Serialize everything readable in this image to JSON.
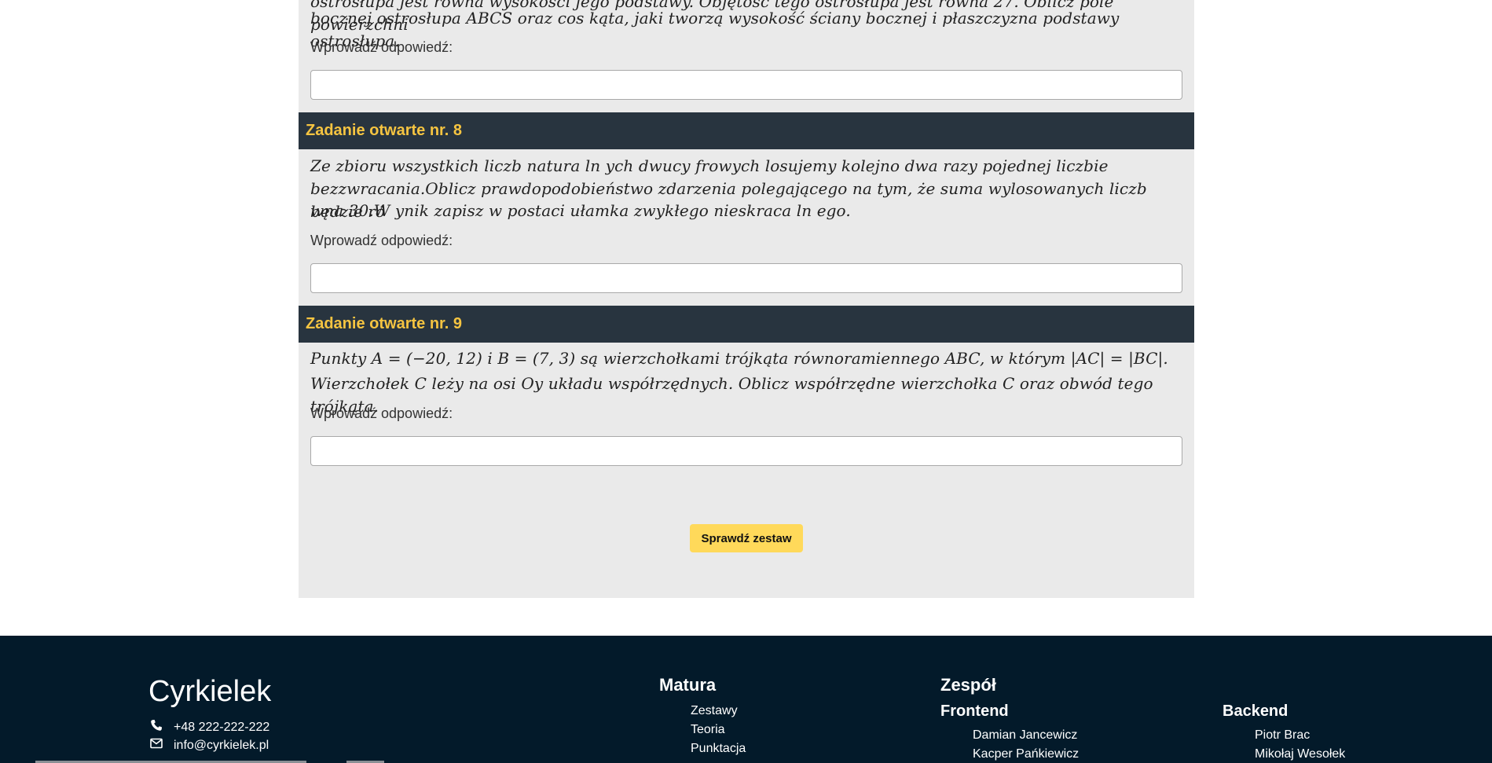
{
  "tasks": {
    "prev": {
      "question_line1": "ostrosłupa jest równa wysokości jego podstawy. Objętość tego ostrosłupa jest równa 27. Oblicz pole powierzchni",
      "question_line2": "bocznej ostrosłupa ABCS oraz cos kąta,  jaki tworzą wysokość ściany bocznej i płaszczyzna podstawy ostrosłupa.",
      "answer_label": "Wprowadź odpowiedź:",
      "answer_value": ""
    },
    "task8": {
      "header": "Zadanie otwarte nr. 8",
      "question_line1": "Ze zbioru wszystkich liczb natura ln ych dwucy frowych losujemy kolejno dwa razy pojednej liczbie",
      "question_line2": "bezzwracania.Oblicz prawdopodobieństwo zdarzenia polegającego na tym, że suma wylosowanych liczb będzie ró",
      "question_line3": "wna 30.W ynik zapisz w postaci ułamka zwykłego nieskraca ln ego.",
      "answer_label": "Wprowadź odpowiedź:",
      "answer_value": ""
    },
    "task9": {
      "header": "Zadanie otwarte nr. 9",
      "question_line1": "Punkty A = (−20, 12) i B = (7, 3) są wierzchołkami trójkąta równoramiennego ABC, w którym |AC| = |BC|.",
      "question_line2": "Wierzchołek C leży na osi Oy układu współrzędnych. Oblicz współrzędne wierzchołka C oraz obwód tego trójkąta.",
      "answer_label": "Wprowadź odpowiedź:",
      "answer_value": ""
    }
  },
  "check_button": "Sprawdź zestaw",
  "footer": {
    "brand": "Cyrkielek",
    "phone": "+48 222-222-222",
    "email": "info@cyrkielek.pl",
    "matura": {
      "title": "Matura",
      "links": [
        "Zestawy",
        "Teoria",
        "Punktacja"
      ]
    },
    "team": {
      "title": "Zespół",
      "frontend": {
        "title": "Frontend",
        "members": [
          "Damian Jancewicz",
          "Kacper Pańkiewicz"
        ]
      },
      "backend": {
        "title": "Backend",
        "members": [
          "Piotr Brac",
          "Mikołaj Wesołek"
        ]
      }
    },
    "icons": {
      "phone": "phone-icon",
      "email": "envelope-icon"
    }
  },
  "colors": {
    "header_bg": "#28343f",
    "header_text": "#f5c441",
    "button_bg": "#ffd95a",
    "footer_bg": "#031a2a",
    "panel_bg": "#eaeaea"
  }
}
